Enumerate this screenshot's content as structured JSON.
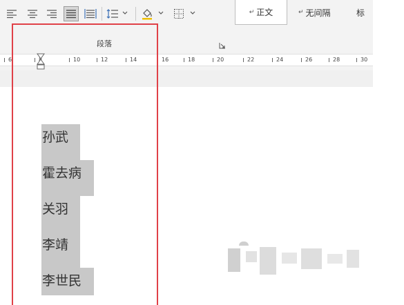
{
  "ribbon": {
    "paragraph_group_label": "段落",
    "styles": {
      "normal": "正文",
      "no_spacing": "无间隔",
      "heading": "标"
    },
    "style_mark": "↵"
  },
  "ruler": {
    "ticks": [
      "6",
      "8",
      "10",
      "12",
      "14",
      "16",
      "18",
      "20",
      "22",
      "24",
      "26",
      "28",
      "30"
    ]
  },
  "document": {
    "lines": [
      "孙武",
      "霍去病",
      "关羽",
      "李靖",
      "李世民"
    ]
  },
  "colors": {
    "highlight": "#c8c8c8",
    "annotation_box": "#e04047",
    "ribbon_bg": "#f3f3f3"
  }
}
